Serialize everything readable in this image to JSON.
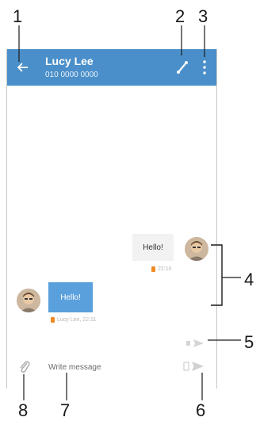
{
  "callouts": {
    "c1": "1",
    "c2": "2",
    "c3": "3",
    "c4": "4",
    "c5": "5",
    "c6": "6",
    "c7": "7",
    "c8": "8"
  },
  "appbar": {
    "contact_name": "Lucy Lee",
    "phone_number": "010 0000 0000",
    "back_icon": "arrow-back-icon",
    "call_icon": "phone-icon",
    "menu_icon": "more-vertical-icon"
  },
  "conversation": {
    "outgoing": {
      "text": "Hello!",
      "time": "22:10"
    },
    "incoming": {
      "text": "Hello!",
      "sender_time": "Lucy Lee, 22:11"
    }
  },
  "composer": {
    "placeholder": "Write message",
    "attach_icon": "paperclip-icon",
    "send_icon": "send-icon"
  },
  "colors": {
    "appbar": "#4a8fc9",
    "incoming_bubble": "#5aa0dc",
    "outgoing_bubble": "#f2f2f2",
    "status_dot": "#f08a24"
  }
}
